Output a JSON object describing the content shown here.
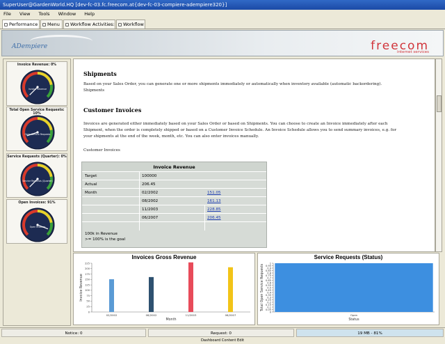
{
  "window": {
    "title": "SuperUser@GardenWorld.HQ [dev-fc-03.fc.freecom.at{dev-fc-03-compiere-adempiere320}]"
  },
  "menu": [
    "File",
    "View",
    "Tools",
    "Window",
    "Help"
  ],
  "tabs": [
    {
      "label": "Performance",
      "icon": "performance-icon"
    },
    {
      "label": "Menu",
      "icon": "menu-icon"
    },
    {
      "label": "Workflow Activities: 1",
      "icon": "workflow-activities-icon"
    },
    {
      "label": "Workflow",
      "icon": "workflow-icon"
    }
  ],
  "banner": {
    "left_logo": "ADempiere",
    "right_logo": "freecom",
    "right_sub": "internet services"
  },
  "gauges": [
    {
      "title": "Invoice Revenue: 0%",
      "label": "Invoice Revenue",
      "value": 0
    },
    {
      "title": "Total Open Service Requests: 10%",
      "label": "Open Service Requests",
      "value": 10
    },
    {
      "title": "Service Requests (Quarter): 0%",
      "label": "Service Requests (Quarter)",
      "value": 0
    },
    {
      "title": "Open Invoices: 91%",
      "label": "Open Invoices",
      "value": 91
    }
  ],
  "content": {
    "shipments_heading": "Shipments",
    "shipments_text": "Based on your Sales Order, you can generate one or more shipments immediately or automatically when inventory available (automatic backordering).",
    "shipments_text2": "Shipments",
    "invoices_heading": "Customer Invoices",
    "invoices_text": "Invoices are generated either immediately based on your Sales Order or based on Shipments. You can choose to create an Invoice immediately after each Shipment, when the order is completely shipped or based on a Customer Invoice Schedule. An Invoice Schedule allows you to send summary invoices, e.g. for your shipments at the end of the week, month, etc. You can also enter invoices manually.",
    "invoices_text2": "Customer Invoices"
  },
  "invoice_table": {
    "title": "Invoice Revenue",
    "target_label": "Target",
    "target_value": "100000",
    "actual_label": "Actual",
    "actual_value": "206.45",
    "month_label": "Month",
    "months": [
      {
        "month": "02/2002",
        "value": "151.05"
      },
      {
        "month": "08/2002",
        "value": "161.13"
      },
      {
        "month": "11/2003",
        "value": "228.85"
      },
      {
        "month": "06/2007",
        "value": "206.45"
      }
    ],
    "note1": "100k in Revenue",
    "note2": ">= 100% is the goal"
  },
  "chart_data": [
    {
      "type": "bar",
      "title": "Invoices Gross Revenue",
      "xlabel": "Month",
      "ylabel": "Invoice Revenue",
      "categories": [
        "02/2002",
        "08/2002",
        "11/2003",
        "06/2007"
      ],
      "values": [
        151.05,
        161.13,
        228.85,
        206.45
      ],
      "colors": [
        "#5b9bd5",
        "#2e5170",
        "#e84b5a",
        "#f2c418"
      ],
      "ylim": [
        0,
        225
      ],
      "yticks": [
        0,
        25,
        50,
        75,
        100,
        125,
        150,
        175,
        200,
        225
      ]
    },
    {
      "type": "bar",
      "title": "Service Requests (Status)",
      "xlabel": "Status",
      "ylabel": "Total Open Service Requests",
      "categories": [
        "Open"
      ],
      "values": [
        1.0
      ],
      "colors": [
        "#3d8fe0"
      ],
      "ylim": [
        0,
        1.0
      ],
      "yticks": [
        0,
        0.05,
        0.1,
        0.15,
        0.2,
        0.25,
        0.3,
        0.35,
        0.4,
        0.45,
        0.5,
        0.55,
        0.6,
        0.65,
        0.7,
        0.75,
        0.8,
        0.85,
        0.9,
        0.95,
        1.0
      ]
    }
  ],
  "status": {
    "notice": "Notice: 0",
    "request": "Request: 0",
    "memory": "19 MB - 81%",
    "bottom": "Dashboard Content Edit"
  }
}
